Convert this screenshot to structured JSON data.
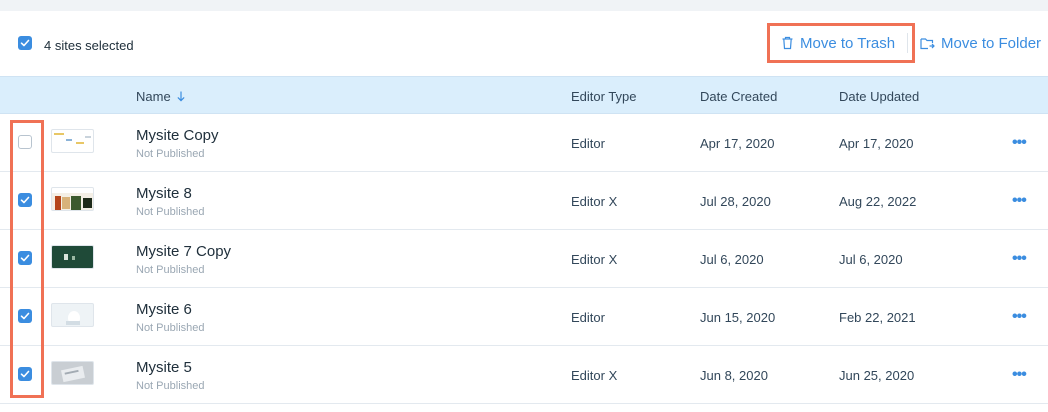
{
  "toolbar": {
    "selected_label": "4 sites selected",
    "move_to_trash": "Move to Trash",
    "move_to_folder": "Move to Folder"
  },
  "table": {
    "headers": {
      "name": "Name",
      "editor_type": "Editor Type",
      "date_created": "Date Created",
      "date_updated": "Date Updated"
    },
    "rows": [
      {
        "name": "Mysite Copy",
        "status": "Not Published",
        "editor": "Editor",
        "created": "Apr 17, 2020",
        "updated": "Apr 17, 2020",
        "checked": false
      },
      {
        "name": "Mysite 8",
        "status": "Not Published",
        "editor": "Editor X",
        "created": "Jul 28, 2020",
        "updated": "Aug 22, 2022",
        "checked": true
      },
      {
        "name": "Mysite 7 Copy",
        "status": "Not Published",
        "editor": "Editor X",
        "created": "Jul 6, 2020",
        "updated": "Jul 6, 2020",
        "checked": true
      },
      {
        "name": "Mysite 6",
        "status": "Not Published",
        "editor": "Editor",
        "created": "Jun 15, 2020",
        "updated": "Feb 22, 2021",
        "checked": true
      },
      {
        "name": "Mysite 5",
        "status": "Not Published",
        "editor": "Editor X",
        "created": "Jun 8, 2020",
        "updated": "Jun 25, 2020",
        "checked": true
      }
    ],
    "more_glyph": "•••"
  },
  "colors": {
    "accent": "#3b8de0",
    "highlight": "#f07155",
    "header_bg": "#daeefc"
  },
  "icons": {
    "trash": "trash-icon",
    "folder": "folder-move-icon",
    "sort": "sort-down-arrow-icon",
    "more": "more-dots-icon"
  }
}
